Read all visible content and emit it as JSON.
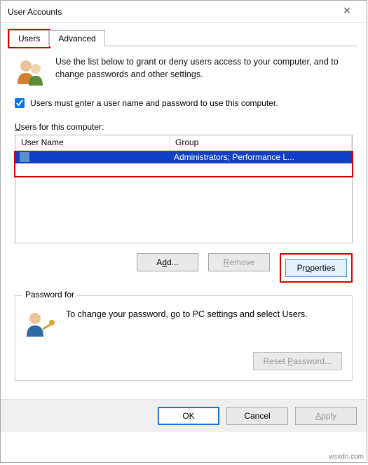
{
  "window": {
    "title": "User Accounts"
  },
  "tabs": {
    "users": "Users",
    "advanced": "Advanced"
  },
  "intro": {
    "text": "Use the list below to grant or deny users access to your computer, and to change passwords and other settings."
  },
  "checkbox": {
    "label_before_e": "Users must ",
    "label_underlined": "e",
    "label_after_e": "nter a user name and password to use this computer.",
    "checked": true
  },
  "list": {
    "label_u": "U",
    "label_rest": "sers for this computer:",
    "col_user": "User Name",
    "col_group": "Group",
    "rows": [
      {
        "user": "",
        "group": "Administrators; Performance L...",
        "selected": true
      }
    ]
  },
  "buttons": {
    "add_pre": "A",
    "add_u": "d",
    "add_post": "d...",
    "remove_pre": "",
    "remove_u": "R",
    "remove_post": "emove",
    "properties_pre": "Pr",
    "properties_u": "o",
    "properties_post": "perties"
  },
  "password_group": {
    "legend": "Password for",
    "text": "To change your password, go to PC settings and select Users.",
    "reset_pre": "Reset ",
    "reset_u": "P",
    "reset_post": "assword..."
  },
  "bottom": {
    "ok": "OK",
    "cancel": "Cancel",
    "apply_pre": "",
    "apply_u": "A",
    "apply_post": "pply"
  },
  "watermark": "wsxdn.com"
}
